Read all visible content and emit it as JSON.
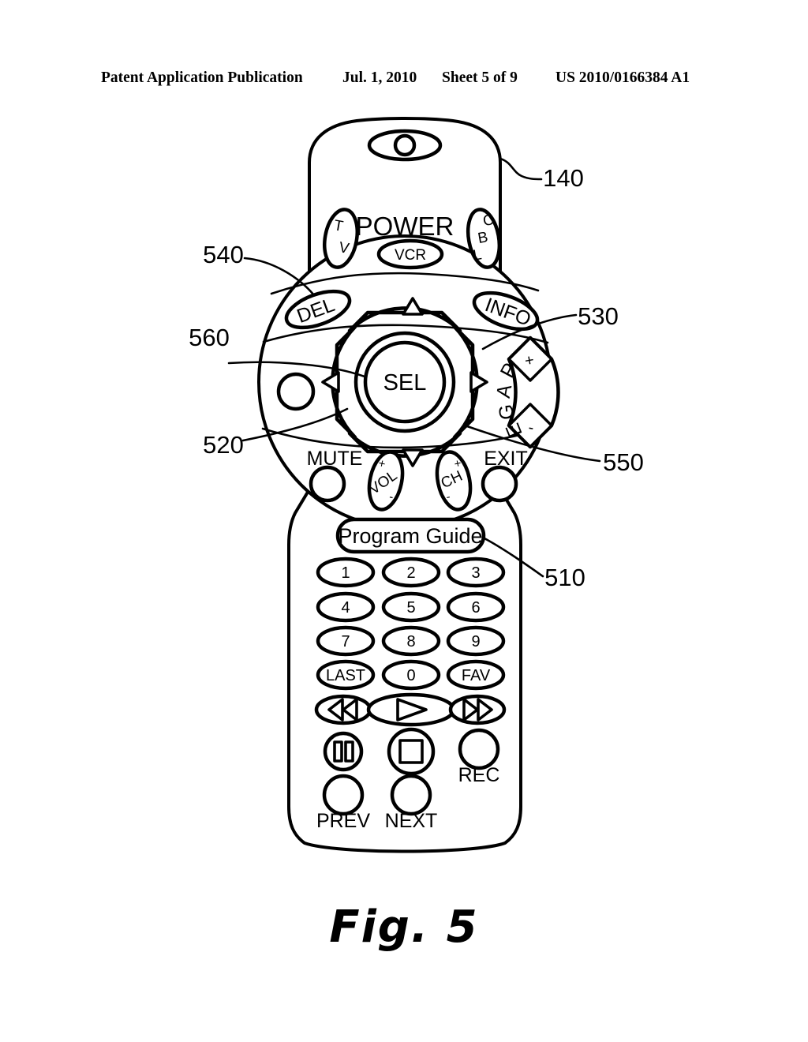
{
  "header": {
    "publication": "Patent Application Publication",
    "date": "Jul. 1, 2010",
    "sheet": "Sheet 5 of 9",
    "number": "US 2010/0166384 A1"
  },
  "figure": {
    "caption": "Fig. 5",
    "subject": "remote-control-device"
  },
  "reference_numerals": {
    "body": "140",
    "program_guide": "510",
    "navigation_disc": "520",
    "right_arrow": "530",
    "del_button": "540",
    "down_arrow": "550",
    "select_button": "560"
  },
  "remote": {
    "ir_emitter": {
      "name": "ir-emitter",
      "glyph": "O"
    },
    "power_section": {
      "label": "POWER",
      "buttons": [
        {
          "name": "tv-power-button",
          "letters": [
            "T",
            "V"
          ]
        },
        {
          "name": "vcr-power-button",
          "label": "VCR"
        },
        {
          "name": "cbl-power-button",
          "letters": [
            "C",
            "B",
            "L"
          ]
        }
      ]
    },
    "navigation": {
      "select_label": "SEL",
      "del_label": "DEL",
      "info_label": "INFO",
      "arrows": [
        {
          "name": "nav-up-arrow",
          "glyph": "triangle-up"
        },
        {
          "name": "nav-right-arrow",
          "glyph": "triangle-right"
        },
        {
          "name": "nav-down-arrow",
          "glyph": "triangle-down"
        },
        {
          "name": "nav-left-arrow",
          "glyph": "triangle-left"
        }
      ],
      "page_rocker": {
        "name": "page-rocker",
        "letters": [
          "P",
          "A",
          "G",
          "E"
        ],
        "plus": "+",
        "minus": "-"
      },
      "unlabeled_button": {
        "name": "unlabeled-round-button"
      }
    },
    "control_row": [
      {
        "name": "mute-button",
        "label": "MUTE"
      },
      {
        "name": "volume-rocker",
        "label": "VOL",
        "plus": "+",
        "minus": "-"
      },
      {
        "name": "channel-rocker",
        "label": "CH",
        "plus": "+",
        "minus": "-"
      },
      {
        "name": "exit-button",
        "label": "EXIT"
      }
    ],
    "program_guide": {
      "name": "program-guide-button",
      "label": "Program Guide"
    },
    "keypad": [
      [
        "1",
        "2",
        "3"
      ],
      [
        "4",
        "5",
        "6"
      ],
      [
        "7",
        "8",
        "9"
      ],
      [
        "LAST",
        "0",
        "FAV"
      ]
    ],
    "transport": {
      "row1": [
        {
          "name": "rewind-button",
          "glyph": "rewind"
        },
        {
          "name": "play-button",
          "glyph": "play"
        },
        {
          "name": "fast-forward-button",
          "glyph": "fast-forward"
        }
      ],
      "row2": [
        {
          "name": "pause-button",
          "glyph": "pause"
        },
        {
          "name": "stop-button",
          "glyph": "stop"
        },
        {
          "name": "record-button",
          "label": "REC"
        }
      ],
      "row3": [
        {
          "name": "previous-button",
          "label": "PREV"
        },
        {
          "name": "next-button",
          "label": "NEXT"
        }
      ]
    }
  },
  "colors": {
    "ink": "#000000",
    "paper": "#ffffff"
  }
}
